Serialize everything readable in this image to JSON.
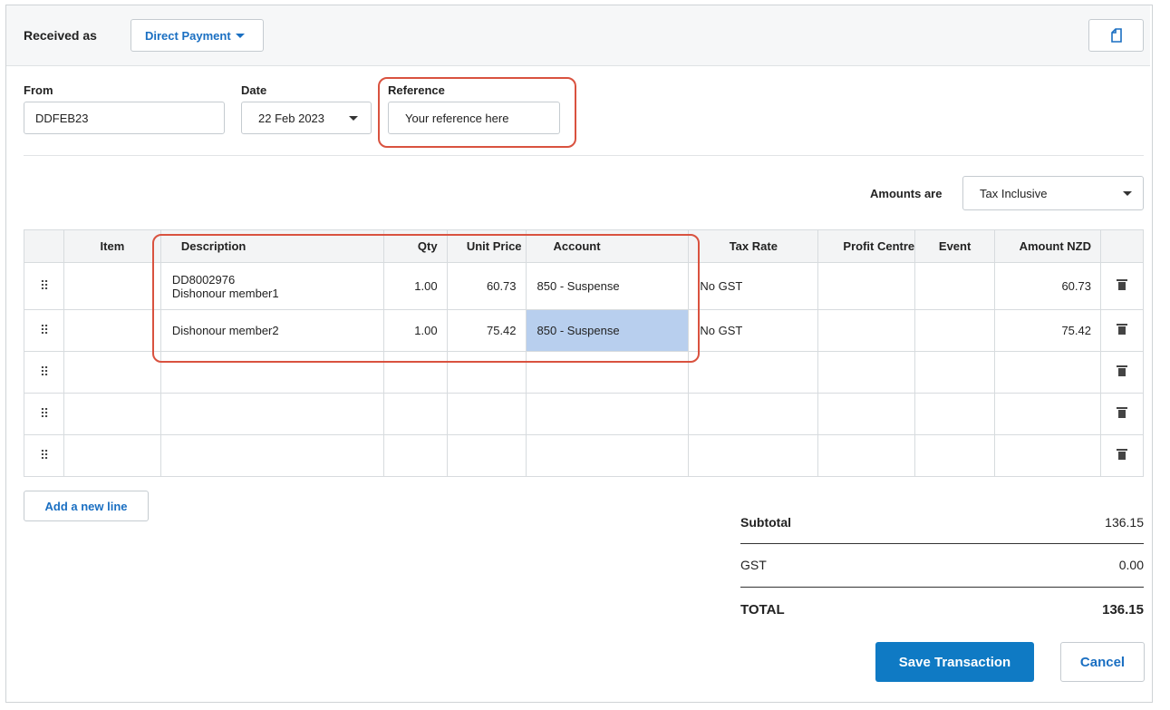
{
  "header": {
    "received_as_label": "Received as",
    "received_as_value": "Direct Payment",
    "copy_icon": "document-icon"
  },
  "form": {
    "from_label": "From",
    "from_value": "DDFEB23",
    "date_label": "Date",
    "date_value": "22 Feb 2023",
    "reference_label": "Reference",
    "reference_value": "Your reference here"
  },
  "amounts": {
    "label": "Amounts are",
    "value": "Tax Inclusive"
  },
  "table": {
    "columns": {
      "item": "Item",
      "description": "Description",
      "qty": "Qty",
      "unit_price": "Unit Price",
      "account": "Account",
      "tax_rate": "Tax Rate",
      "profit_centre": "Profit Centre",
      "event": "Event",
      "amount": "Amount NZD"
    },
    "rows": [
      {
        "item": "",
        "desc1": "DD8002976",
        "desc2": "Dishonour member1",
        "qty": "1.00",
        "unit_price": "60.73",
        "account": "850 - Suspense",
        "tax_rate": "No GST",
        "profit_centre": "",
        "event": "",
        "amount": "60.73"
      },
      {
        "item": "",
        "desc1": "Dishonour member2",
        "desc2": "",
        "qty": "1.00",
        "unit_price": "75.42",
        "account": "850 - Suspense",
        "tax_rate": "No GST",
        "profit_centre": "",
        "event": "",
        "amount": "75.42"
      }
    ],
    "drag_glyph": "⠿",
    "empty_rows": 3
  },
  "add_line": "Add a new line",
  "totals": {
    "subtotal_label": "Subtotal",
    "subtotal_value": "136.15",
    "gst_label": "GST",
    "gst_value": "0.00",
    "total_label": "TOTAL",
    "total_value": "136.15"
  },
  "actions": {
    "save": "Save Transaction",
    "cancel": "Cancel"
  },
  "colors": {
    "accent": "#1a6fc2",
    "primary_button": "#0f7ac4",
    "highlight": "#d9523f",
    "selected_cell": "#b8cfee"
  }
}
